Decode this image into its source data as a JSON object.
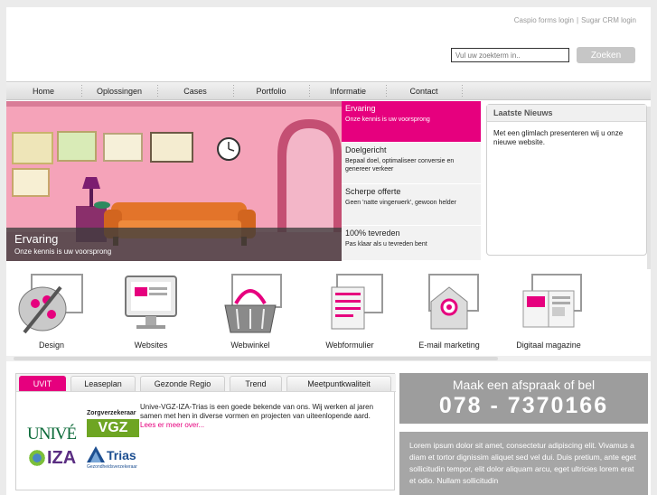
{
  "header": {
    "links": [
      "Caspio forms login",
      "Sugar CRM login"
    ],
    "separator": "|"
  },
  "search": {
    "placeholder": "Vul uw zoekterm in..",
    "button_label": "Zoeken"
  },
  "nav": {
    "items": [
      "Home",
      "Oplossingen",
      "Cases",
      "Portfolio",
      "Informatie",
      "Contact"
    ]
  },
  "slider": {
    "caption_title": "Ervaring",
    "caption_subtitle": "Onze kennis is uw voorsprong",
    "tabs": [
      {
        "title": "Ervaring",
        "subtitle": "Onze kennis is uw voorsprong"
      },
      {
        "title": "Doelgericht",
        "subtitle": "Bepaal doel, optimaliseer conversie en genereer verkeer"
      },
      {
        "title": "Scherpe offerte",
        "subtitle": "Geen 'natte vingerwerk', gewoon helder"
      },
      {
        "title": "100% tevreden",
        "subtitle": "Pas klaar als u tevreden bent"
      }
    ]
  },
  "news": {
    "title": "Laatste Nieuws",
    "text": "Met een glimlach presenteren wij u onze nieuwe website."
  },
  "services": {
    "items": [
      "Design",
      "Websites",
      "Webwinkel",
      "Webformulier",
      "E-mail marketing",
      "Digitaal magazine"
    ]
  },
  "partners": {
    "tabs": [
      "UVIT",
      "Leaseplan",
      "Gezonde Regio",
      "Trend",
      "Meetpuntkwaliteit"
    ],
    "text": "Unive-VGZ-IZA-Trias is een goede bekende van ons. Wij werken al jaren samen met hen in diverse vormen en projecten van uiteenlopende aard.",
    "more_link": "Lees er meer over...",
    "logos": {
      "unive": "UNIVÉ",
      "zorg": "Zorgverzekeraar",
      "vgz": "VGZ",
      "iza": "IZA",
      "trias": "Trias",
      "trias_sub": "Gezondheidsverzekeraar"
    }
  },
  "cta": {
    "title": "Maak een afspraak of bel",
    "phone": "078 - 7370166"
  },
  "lorem": {
    "text": "Lorem ipsum dolor sit amet, consectetur adipiscing elit. Vivamus a diam et tortor dignissim aliquet sed vel dui. Duis pretium, ante eget sollicitudin tempor, elit dolor aliquam arcu, eget ultricies lorem erat et odio. Nullam sollicitudin"
  },
  "colors": {
    "accent": "#e6007e",
    "cta_bg": "#9d9d9d",
    "wall": "#f5a3b9"
  }
}
